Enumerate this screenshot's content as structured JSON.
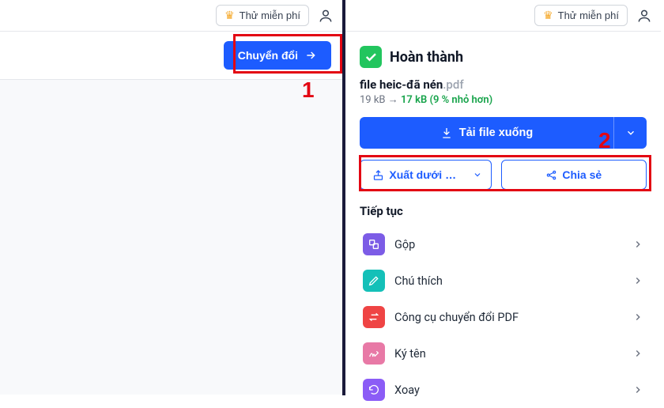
{
  "header": {
    "try_free_label": "Thử miễn phí"
  },
  "left": {
    "convert_label": "Chuyển đổi",
    "annotation_number": "1"
  },
  "right": {
    "done_label": "Hoàn thành",
    "file_name": "file heic-đã nén",
    "file_ext": ".pdf",
    "size_old": "19 kB",
    "size_arrow": "→",
    "size_new": "17 kB",
    "size_pct": "(9 % nhỏ hơn)",
    "download_label": "Tải file xuống",
    "export_label": "Xuất dưới …",
    "share_label": "Chia sẻ",
    "continue_title": "Tiếp tục",
    "annotation_number": "2",
    "continue_items": [
      {
        "label": "Gộp",
        "icon": "merge",
        "color": "ico-purple"
      },
      {
        "label": "Chú thích",
        "icon": "pencil",
        "color": "ico-teal"
      },
      {
        "label": "Công cụ chuyển đổi PDF",
        "icon": "swap",
        "color": "ico-red"
      },
      {
        "label": "Ký tên",
        "icon": "sign",
        "color": "ico-pink"
      },
      {
        "label": "Xoay",
        "icon": "rotate",
        "color": "ico-violet"
      }
    ]
  }
}
